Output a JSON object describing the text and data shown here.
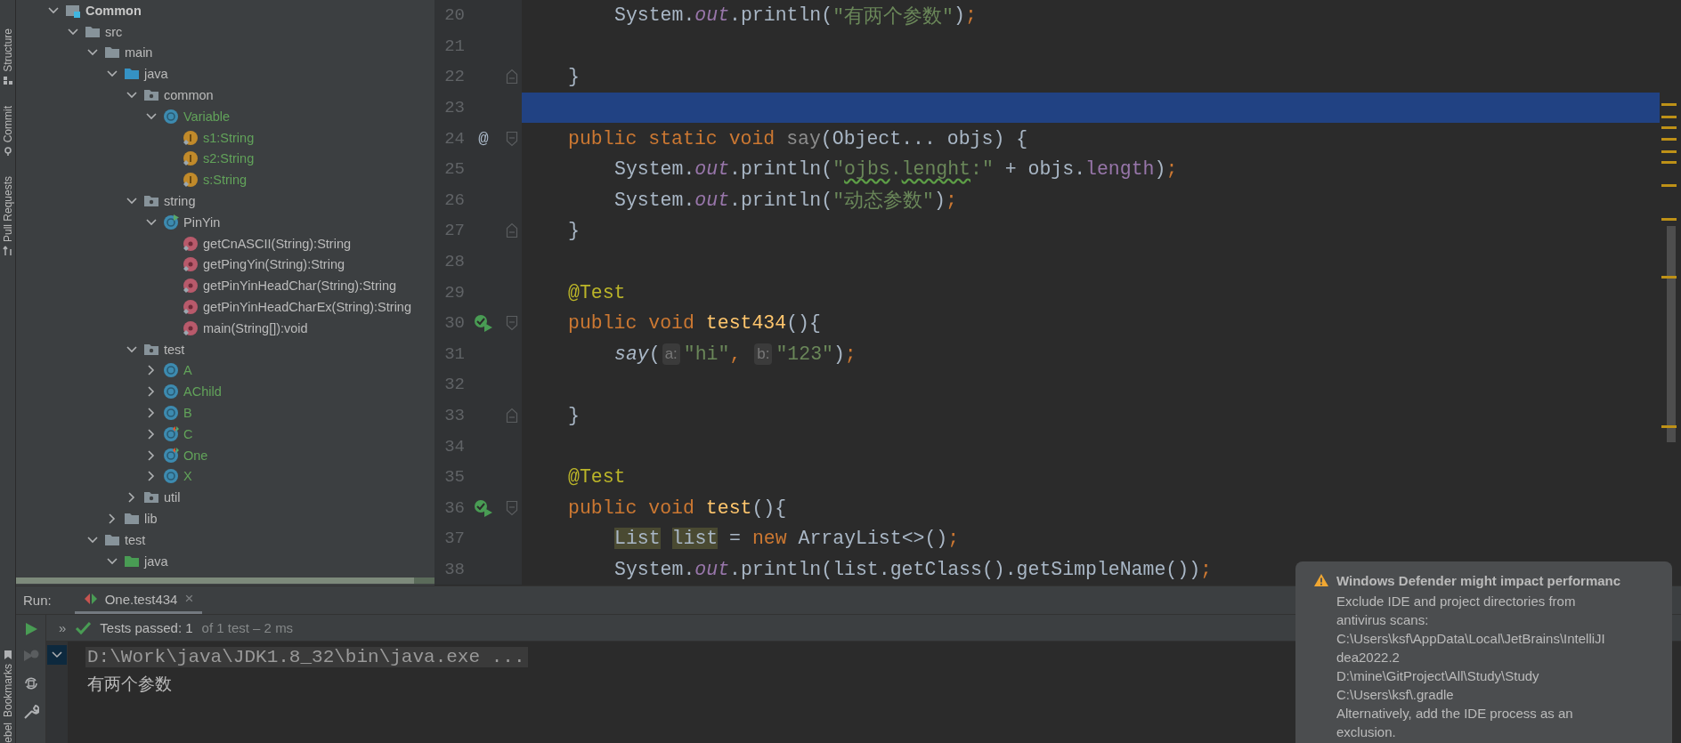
{
  "left_strip": {
    "top_tabs": [
      {
        "label": "Structure",
        "kind": "structure"
      },
      {
        "label": "Commit",
        "kind": "commit"
      },
      {
        "label": "Pull Requests",
        "kind": "pull"
      }
    ],
    "bottom_tabs": [
      {
        "label": "Bookmarks",
        "kind": "bookmarks"
      },
      {
        "label": "ebel",
        "kind": "plain"
      }
    ]
  },
  "project_tree": [
    {
      "label": "Common",
      "kind": "module",
      "expanded": true,
      "color": "#c8c8c8",
      "children": [
        {
          "label": "src",
          "kind": "folder",
          "expanded": true,
          "color": "#bbbbbb",
          "children": [
            {
              "label": "main",
              "kind": "folder",
              "expanded": true,
              "color": "#bbbbbb",
              "children": [
                {
                  "label": "java",
                  "kind": "source_folder",
                  "expanded": true,
                  "color": "#bbbbbb",
                  "children": [
                    {
                      "label": "common",
                      "kind": "package",
                      "expanded": true,
                      "color": "#bbbbbb",
                      "children": [
                        {
                          "label": "Variable",
                          "kind": "class",
                          "expanded": true,
                          "color": "#62a35a",
                          "children": [
                            {
                              "label": "s1:String",
                              "kind": "field",
                              "color": "#62a35a"
                            },
                            {
                              "label": "s2:String",
                              "kind": "field",
                              "color": "#62a35a"
                            },
                            {
                              "label": "s:String",
                              "kind": "field",
                              "color": "#62a35a"
                            }
                          ]
                        }
                      ]
                    },
                    {
                      "label": "string",
                      "kind": "package",
                      "expanded": true,
                      "color": "#bbbbbb",
                      "children": [
                        {
                          "label": "PinYin",
                          "kind": "main_class",
                          "expanded": true,
                          "color": "#bbbbbb",
                          "children": [
                            {
                              "label": "getCnASCII(String):String",
                              "kind": "method",
                              "color": "#bbbbbb"
                            },
                            {
                              "label": "getPingYin(String):String",
                              "kind": "method",
                              "color": "#bbbbbb"
                            },
                            {
                              "label": "getPinYinHeadChar(String):String",
                              "kind": "method",
                              "color": "#bbbbbb"
                            },
                            {
                              "label": "getPinYinHeadCharEx(String):String",
                              "kind": "method",
                              "color": "#bbbbbb"
                            },
                            {
                              "label": "main(String[]):void",
                              "kind": "method",
                              "color": "#bbbbbb"
                            }
                          ]
                        }
                      ]
                    },
                    {
                      "label": "test",
                      "kind": "package",
                      "expanded": true,
                      "color": "#bbbbbb",
                      "children": [
                        {
                          "label": "A",
                          "kind": "class",
                          "expanded": false,
                          "color": "#62a35a"
                        },
                        {
                          "label": "AChild",
                          "kind": "class",
                          "expanded": false,
                          "color": "#62a35a"
                        },
                        {
                          "label": "B",
                          "kind": "class",
                          "expanded": false,
                          "color": "#62a35a"
                        },
                        {
                          "label": "C",
                          "kind": "test_class",
                          "expanded": false,
                          "color": "#62a35a"
                        },
                        {
                          "label": "One",
                          "kind": "test_class",
                          "expanded": false,
                          "color": "#62a35a"
                        },
                        {
                          "label": "X",
                          "kind": "class",
                          "expanded": false,
                          "color": "#62a35a"
                        }
                      ]
                    },
                    {
                      "label": "util",
                      "kind": "package",
                      "expanded": false,
                      "color": "#bbbbbb"
                    }
                  ]
                },
                {
                  "label": "lib",
                  "kind": "folder",
                  "expanded": false,
                  "color": "#bbbbbb"
                }
              ]
            },
            {
              "label": "test",
              "kind": "folder",
              "expanded": true,
              "color": "#bbbbbb",
              "children": [
                {
                  "label": "java",
                  "kind": "test_source_folder",
                  "expanded": true,
                  "color": "#bbbbbb"
                }
              ]
            }
          ]
        }
      ]
    }
  ],
  "editor": {
    "lines": [
      {
        "number": "20",
        "current": false,
        "scope": {
          "kind": "method"
        },
        "tokens": [
          {
            "kind": "text",
            "text": "System."
          },
          {
            "kind": "static_field",
            "text": "out"
          },
          {
            "kind": "text",
            "text": ".println("
          },
          {
            "kind": "string",
            "text": "\"有两个参数\""
          },
          {
            "kind": "text",
            "text": ")"
          },
          {
            "kind": "keyword",
            "text": ";"
          }
        ]
      },
      {
        "number": "21",
        "current": false
      },
      {
        "number": "22",
        "current": false,
        "fold": {
          "kind": "end"
        },
        "scope": {
          "kind": "class"
        },
        "tokens": [
          {
            "kind": "text",
            "text": "}"
          }
        ]
      },
      {
        "number": "23",
        "current": true
      },
      {
        "number": "24",
        "current": false,
        "gutter": {
          "kind": "text",
          "text": "@"
        },
        "fold": {
          "kind": "start"
        },
        "scope": {
          "kind": "class"
        },
        "tokens": [
          {
            "kind": "keyword",
            "text": "public static void "
          },
          {
            "kind": "unused",
            "text": "say"
          },
          {
            "kind": "text",
            "text": "(Object... objs) {"
          }
        ]
      },
      {
        "number": "25",
        "current": false,
        "scope": {
          "kind": "method"
        },
        "tokens": [
          {
            "kind": "text",
            "text": "System."
          },
          {
            "kind": "static_field",
            "text": "out"
          },
          {
            "kind": "text",
            "text": ".println("
          },
          {
            "kind": "string",
            "text": "\""
          },
          {
            "kind": "typo",
            "text": "ojbs"
          },
          {
            "kind": "string",
            "text": "."
          },
          {
            "kind": "typo",
            "text": "lenght"
          },
          {
            "kind": "string",
            "text": ":\""
          },
          {
            "kind": "text",
            "text": " + objs."
          },
          {
            "kind": "field",
            "text": "length"
          },
          {
            "kind": "text",
            "text": ")"
          },
          {
            "kind": "keyword",
            "text": ";"
          }
        ]
      },
      {
        "number": "26",
        "current": false,
        "scope": {
          "kind": "method"
        },
        "tokens": [
          {
            "kind": "text",
            "text": "System."
          },
          {
            "kind": "static_field",
            "text": "out"
          },
          {
            "kind": "text",
            "text": ".println("
          },
          {
            "kind": "string",
            "text": "\"动态参数\""
          },
          {
            "kind": "text",
            "text": ")"
          },
          {
            "kind": "keyword",
            "text": ";"
          }
        ]
      },
      {
        "number": "27",
        "current": false,
        "fold": {
          "kind": "end"
        },
        "scope": {
          "kind": "class"
        },
        "tokens": [
          {
            "kind": "text",
            "text": "}"
          }
        ]
      },
      {
        "number": "28",
        "current": false
      },
      {
        "number": "29",
        "current": false,
        "scope": {
          "kind": "class"
        },
        "tokens": [
          {
            "kind": "annotation",
            "text": "@Test"
          }
        ]
      },
      {
        "number": "30",
        "current": false,
        "gutter": {
          "kind": "run"
        },
        "fold": {
          "kind": "start"
        },
        "scope": {
          "kind": "class"
        },
        "tokens": [
          {
            "kind": "keyword",
            "text": "public void "
          },
          {
            "kind": "method_decl",
            "text": "test434"
          },
          {
            "kind": "text",
            "text": "(){"
          }
        ]
      },
      {
        "number": "31",
        "current": false,
        "scope": {
          "kind": "method"
        },
        "tokens": [
          {
            "kind": "call",
            "text": "say"
          },
          {
            "kind": "text",
            "text": "("
          },
          {
            "kind": "hint",
            "text": "a:"
          },
          {
            "kind": "string",
            "text": "\"hi\""
          },
          {
            "kind": "keyword",
            "text": ", "
          },
          {
            "kind": "hint",
            "text": "b:"
          },
          {
            "kind": "string",
            "text": "\"123\""
          },
          {
            "kind": "text",
            "text": ")"
          },
          {
            "kind": "keyword",
            "text": ";"
          }
        ]
      },
      {
        "number": "32",
        "current": false
      },
      {
        "number": "33",
        "current": false,
        "fold": {
          "kind": "end"
        },
        "scope": {
          "kind": "class"
        },
        "tokens": [
          {
            "kind": "text",
            "text": "}"
          }
        ]
      },
      {
        "number": "34",
        "current": false
      },
      {
        "number": "35",
        "current": false,
        "scope": {
          "kind": "class"
        },
        "tokens": [
          {
            "kind": "annotation",
            "text": "@Test"
          }
        ]
      },
      {
        "number": "36",
        "current": false,
        "gutter": {
          "kind": "run"
        },
        "fold": {
          "kind": "start"
        },
        "scope": {
          "kind": "class"
        },
        "tokens": [
          {
            "kind": "keyword",
            "text": "public void "
          },
          {
            "kind": "method_decl",
            "text": "test"
          },
          {
            "kind": "text",
            "text": "(){"
          }
        ]
      },
      {
        "number": "37",
        "current": false,
        "scope": {
          "kind": "method"
        },
        "tokens": [
          {
            "kind": "usage",
            "text": "List"
          },
          {
            "kind": "usage",
            "text": "list"
          },
          {
            "kind": "text",
            "text": " = "
          },
          {
            "kind": "keyword",
            "text": "new "
          },
          {
            "kind": "text",
            "text": "ArrayList<>()"
          },
          {
            "kind": "keyword",
            "text": ";"
          }
        ]
      },
      {
        "number": "38",
        "current": false,
        "scope": {
          "kind": "method"
        },
        "tokens": [
          {
            "kind": "text",
            "text": "System."
          },
          {
            "kind": "static_field",
            "text": "out"
          },
          {
            "kind": "text",
            "text": ".println(list.getClass().getSimpleName())"
          },
          {
            "kind": "keyword",
            "text": ";"
          }
        ]
      }
    ]
  },
  "run_panel": {
    "label": "Run:",
    "tabs": [
      {
        "label": "One.test434",
        "close": "×",
        "selected": true
      }
    ],
    "chevron": "»",
    "status": {
      "passed": "Tests passed: 1",
      "detail": "of 1 test – 2 ms"
    },
    "console": [
      {
        "kind": "command",
        "text": "D:\\Work\\java\\JDK1.8_32\\bin\\java.exe ..."
      },
      {
        "kind": "output",
        "text": "有两个参数"
      }
    ]
  },
  "notification": {
    "title": "Windows Defender might impact performanc",
    "body_lines": [
      "Exclude IDE and project directories from",
      "antivirus scans:",
      "C:\\Users\\ksf\\AppData\\Local\\JetBrains\\IntelliJI",
      "dea2022.2",
      "D:\\mine\\GitProject\\All\\Study\\Study",
      "C:\\Users\\ksf\\.gradle",
      "Alternatively, add the IDE process as an",
      "exclusion."
    ]
  }
}
